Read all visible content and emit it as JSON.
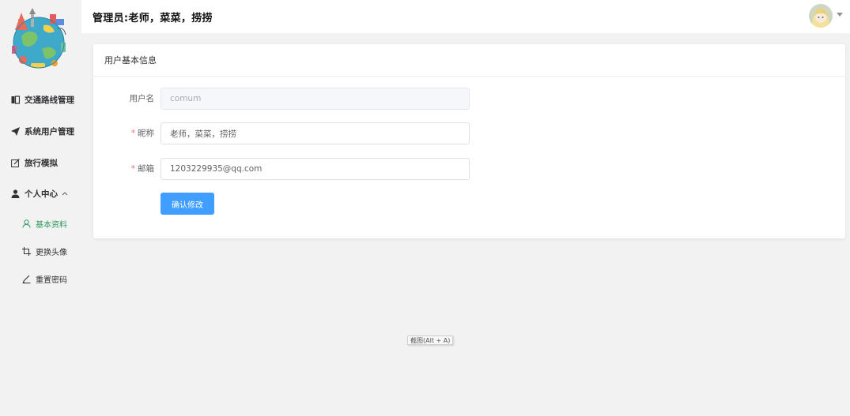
{
  "header": {
    "title": "管理员:老师，菜菜，捞捞"
  },
  "sidebar": {
    "items": [
      {
        "label": "交通路线管理",
        "icon": "book-icon"
      },
      {
        "label": "系统用户管理",
        "icon": "paper-plane-icon"
      },
      {
        "label": "旅行模拟",
        "icon": "edit-icon"
      },
      {
        "label": "个人中心",
        "icon": "user-icon",
        "expanded": true
      }
    ],
    "sub_items": [
      {
        "label": "基本资料",
        "icon": "user-outline-icon",
        "active": true
      },
      {
        "label": "更换头像",
        "icon": "crop-icon"
      },
      {
        "label": "重置密码",
        "icon": "pen-icon"
      }
    ]
  },
  "card": {
    "title": "用户基本信息"
  },
  "form": {
    "username": {
      "label": "用户名",
      "value": "comum",
      "disabled": true
    },
    "nickname": {
      "label": "昵称",
      "value": "老师，菜菜，捞捞",
      "required": true
    },
    "email": {
      "label": "邮箱",
      "value": "1203229935@qq.com",
      "required": true
    },
    "submit_label": "确认修改"
  },
  "tooltip": "截图(Alt + A)",
  "colors": {
    "accent": "#409eff",
    "active_menu": "#2e9a5c",
    "required": "#f56c6c"
  }
}
